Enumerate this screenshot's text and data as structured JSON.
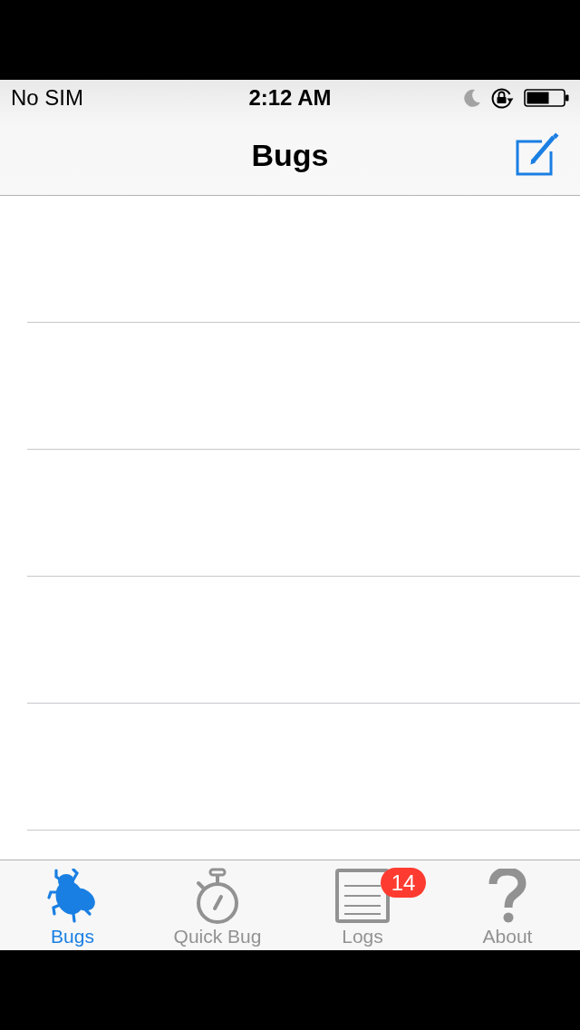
{
  "status_bar": {
    "carrier": "No SIM",
    "time": "2:12 AM",
    "do_not_disturb": true,
    "rotation_lock": true
  },
  "nav_bar": {
    "title": "Bugs"
  },
  "tabs": [
    {
      "label": "Bugs",
      "selected": true,
      "kind": "fly"
    },
    {
      "label": "Quick Bug",
      "selected": false,
      "kind": "stopwatch"
    },
    {
      "label": "Logs",
      "selected": false,
      "kind": "document",
      "badge": "14"
    },
    {
      "label": "About",
      "selected": false,
      "kind": "question"
    }
  ]
}
